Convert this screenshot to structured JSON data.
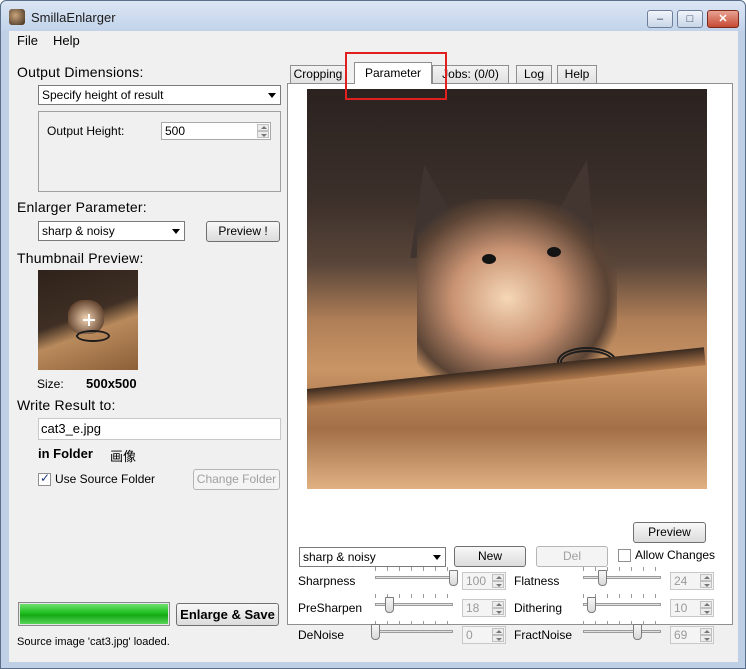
{
  "window": {
    "title": "SmillaEnlarger",
    "min_glyph": "–",
    "max_glyph": "□",
    "close_glyph": "✕"
  },
  "menu": {
    "items": [
      "File",
      "Help"
    ]
  },
  "left": {
    "output_dimensions": {
      "title": "Output Dimensions:",
      "mode": "Specify height of result",
      "height_label": "Output Height:",
      "height_value": "500"
    },
    "enlarger": {
      "title": "Enlarger Parameter:",
      "preset": "sharp & noisy",
      "preview_button": "Preview !"
    },
    "thumbnail": {
      "title": "Thumbnail Preview:",
      "size_label": "Size:",
      "size_value": "500x500"
    },
    "write_result": {
      "title": "Write Result to:",
      "filename": "cat3_e.jpg",
      "in_folder_label": "in Folder",
      "folder_name": "画像",
      "use_source_label": "Use Source Folder",
      "use_source_checked": true,
      "change_folder_button": "Change Folder"
    },
    "progress": {
      "value": 1.0
    },
    "enlarge_button": "Enlarge & Save",
    "status": "Source image 'cat3.jpg' loaded."
  },
  "tabs": {
    "items": [
      "Cropping",
      "Parameter",
      "Jobs: (0/0)",
      "Log",
      "Help"
    ],
    "active": "Parameter"
  },
  "parameter": {
    "preview_button": "Preview",
    "preset": "sharp & noisy",
    "new_button": "New",
    "del_button": "Del",
    "allow_changes_label": "Allow Changes",
    "allow_changes_checked": false,
    "sliders": {
      "sharpness": {
        "label": "Sharpness",
        "value": "100",
        "level": 1.0
      },
      "presharpen": {
        "label": "PreSharpen",
        "value": "18",
        "level": 0.18
      },
      "denoise": {
        "label": "DeNoise",
        "value": "0",
        "level": 0.0
      },
      "flatness": {
        "label": "Flatness",
        "value": "24",
        "level": 0.24
      },
      "dithering": {
        "label": "Dithering",
        "value": "10",
        "level": 0.1
      },
      "fractnoise": {
        "label": "FractNoise",
        "value": "69",
        "level": 0.69
      }
    }
  },
  "colors": {
    "accent": "#e02020",
    "progress": "#1fbf1f",
    "window_frame": "#bfcfe5"
  }
}
